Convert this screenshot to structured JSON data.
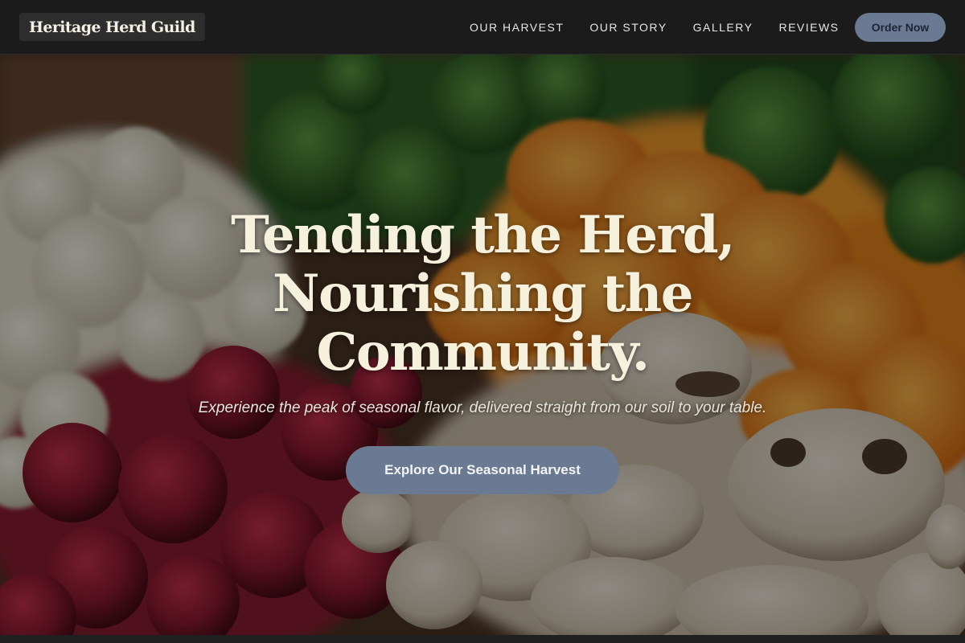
{
  "header": {
    "logo": "Heritage Herd Guild",
    "nav": [
      {
        "label": "OUR HARVEST"
      },
      {
        "label": "OUR STORY"
      },
      {
        "label": "GALLERY"
      },
      {
        "label": "REVIEWS"
      }
    ],
    "cta_label": "Order Now"
  },
  "hero": {
    "title": "Tending the Herd, Nourishing the Community.",
    "subtitle": "Experience the peak of seasonal flavor, delivered straight from our soil to your table.",
    "cta_label": "Explore Our Seasonal Harvest",
    "background_image": "vegetable-produce-photo"
  },
  "colors": {
    "header_bg": "#1b1b1b",
    "button_bg": "#6b7a93",
    "title_text": "#f5f1dc"
  }
}
